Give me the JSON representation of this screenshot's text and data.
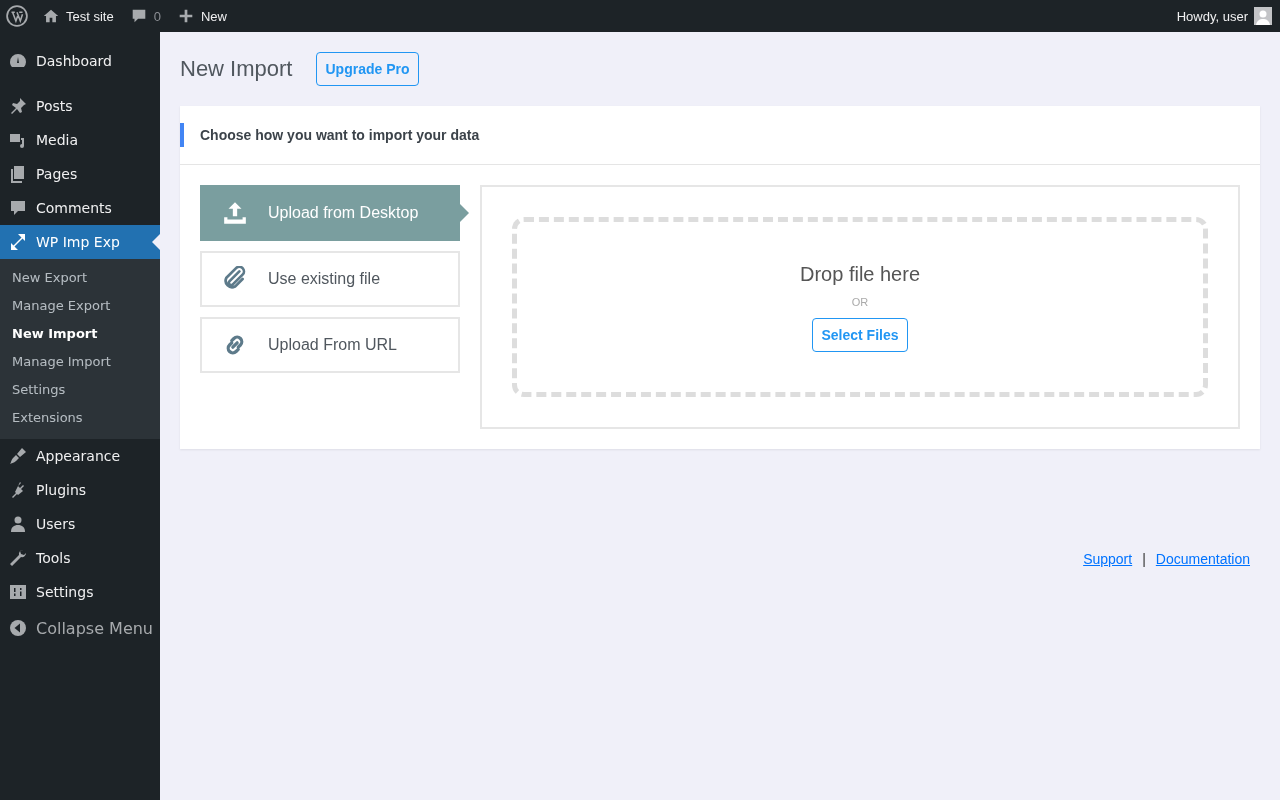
{
  "admin_bar": {
    "site_name": "Test site",
    "comments_count": "0",
    "new_label": "New",
    "greeting": "Howdy, user"
  },
  "sidebar": {
    "sections": [
      [
        {
          "label": "Dashboard",
          "selected": false
        }
      ],
      [
        {
          "label": "Posts",
          "selected": false
        },
        {
          "label": "Media",
          "selected": false
        },
        {
          "label": "Pages",
          "selected": false
        },
        {
          "label": "Comments",
          "selected": false
        },
        {
          "label": "WP Imp Exp",
          "selected": true,
          "children": [
            {
              "label": "New Export",
              "selected": false
            },
            {
              "label": "Manage Export",
              "selected": false
            },
            {
              "label": "New Import",
              "selected": true
            },
            {
              "label": "Manage Import",
              "selected": false
            },
            {
              "label": "Settings",
              "selected": false
            },
            {
              "label": "Extensions",
              "selected": false
            }
          ]
        }
      ],
      [
        {
          "label": "Appearance",
          "selected": false
        },
        {
          "label": "Plugins",
          "selected": false
        },
        {
          "label": "Users",
          "selected": false
        },
        {
          "label": "Tools",
          "selected": false
        },
        {
          "label": "Settings",
          "selected": false
        }
      ]
    ],
    "collapse_label": "Collapse Menu"
  },
  "page": {
    "title": "New Import",
    "upgrade_button": "Upgrade Pro",
    "card_heading": "Choose how you want to import your data",
    "methods": [
      {
        "label": "Upload from Desktop",
        "selected": true
      },
      {
        "label": "Use existing file",
        "selected": false
      },
      {
        "label": "Upload From URL",
        "selected": false
      }
    ],
    "dropzone": {
      "title": "Drop file here",
      "separator": "OR",
      "button": "Select Files"
    }
  },
  "footer_links": [
    "Support",
    "Documentation"
  ],
  "footer_separator": "|"
}
